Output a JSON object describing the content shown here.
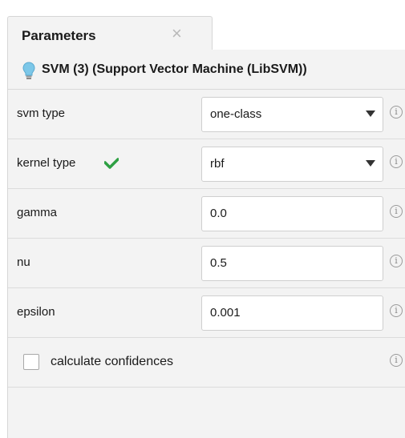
{
  "tab": {
    "title": "Parameters",
    "close_glyph": "×"
  },
  "operator": {
    "title": "SVM (3) (Support Vector Machine (LibSVM))",
    "icon": "lightbulb-icon"
  },
  "params": {
    "svm_type": {
      "label": "svm type",
      "value": "one-class"
    },
    "kernel_type": {
      "label": "kernel type",
      "value": "rbf"
    },
    "gamma": {
      "label": "gamma",
      "value": "0.0"
    },
    "nu": {
      "label": "nu",
      "value": "0.5"
    },
    "epsilon": {
      "label": "epsilon",
      "value": "0.001"
    },
    "calculate_confidences": {
      "label": "calculate confidences",
      "checked": false
    }
  },
  "info_glyph": "i",
  "colors": {
    "check": "#2ea043",
    "bulb": "#7cc7e8"
  }
}
